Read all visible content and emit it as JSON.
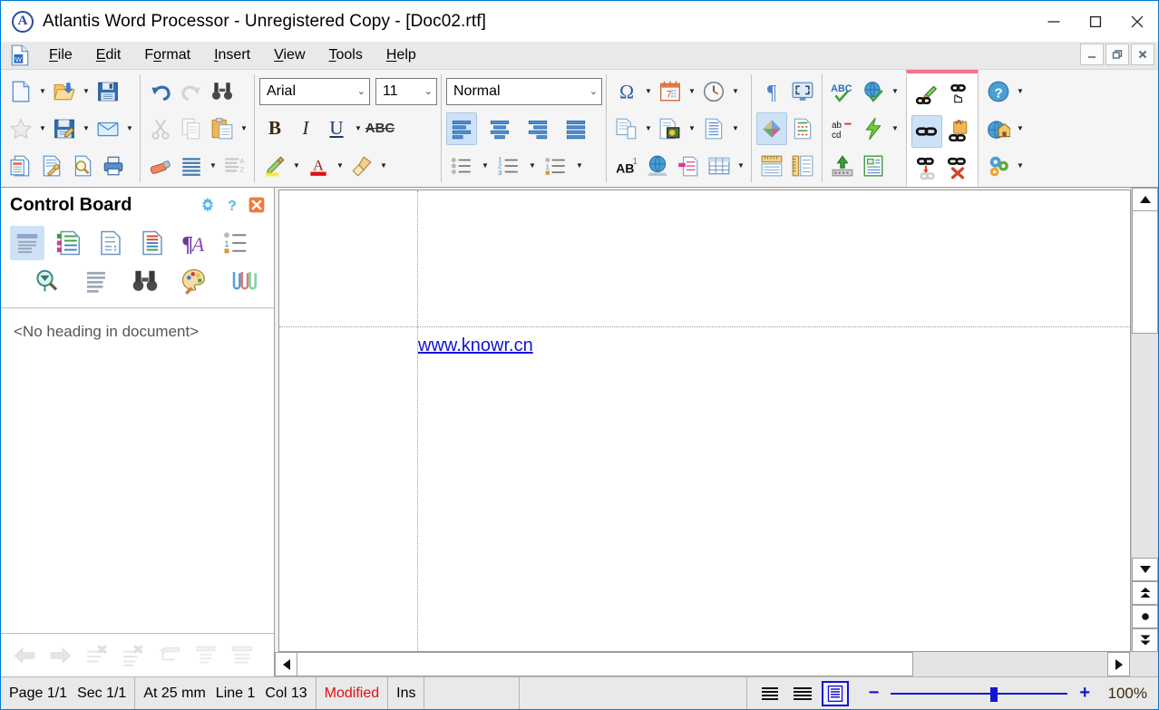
{
  "window": {
    "title": "Atlantis Word Processor - Unregistered Copy - [Doc02.rtf]",
    "logo_letter": "A",
    "minimize_label": "Minimize",
    "maximize_label": "Maximize",
    "close_label": "Close"
  },
  "menubar": {
    "items": [
      {
        "label": "File",
        "accel": "F"
      },
      {
        "label": "Edit",
        "accel": "E"
      },
      {
        "label": "Format",
        "accel": "o"
      },
      {
        "label": "Insert",
        "accel": "I"
      },
      {
        "label": "View",
        "accel": "V"
      },
      {
        "label": "Tools",
        "accel": "T"
      },
      {
        "label": "Help",
        "accel": "H"
      }
    ],
    "mdi": {
      "minimize": "_",
      "restore": "❐",
      "close": "✕"
    }
  },
  "toolbar": {
    "groups": [
      {
        "name": "file-group",
        "buttons": [
          "new-document-icon",
          "open-document-icon",
          "save-icon",
          "favorites-star-icon",
          "save-as-icon",
          "send-mail-icon",
          "document-properties-icon",
          "document-setup-icon",
          "print-preview-icon",
          "print-icon"
        ]
      },
      {
        "name": "edit-group",
        "buttons": [
          "undo-icon",
          "redo-icon",
          "find-icon",
          "cut-icon",
          "copy-icon",
          "paste-icon",
          "clear-formatting-icon",
          "paragraph-lines-icon",
          "sort-icon"
        ]
      },
      {
        "name": "font-group",
        "font_name": "Arial",
        "font_size": "11",
        "bold_label": "B",
        "italic_label": "I",
        "underline_label": "U",
        "strikethrough_label": "ABC",
        "buttons": [
          "highlight-icon",
          "font-color-icon",
          "format-painter-icon"
        ]
      },
      {
        "name": "paragraph-group",
        "style_name": "Normal",
        "buttons": [
          "align-left-icon",
          "align-center-icon",
          "align-right-icon",
          "align-justify-icon",
          "bullet-list-icon",
          "numbered-list-icon",
          "multilevel-list-icon"
        ]
      },
      {
        "name": "insert-group",
        "buttons": [
          "symbol-icon",
          "date-icon",
          "time-icon",
          "page-break-icon",
          "picture-icon",
          "text-box-icon",
          "footnote-icon",
          "hyperlink-globe-icon",
          "bookmark-icon",
          "table-icon"
        ]
      },
      {
        "name": "view-group",
        "buttons": [
          "show-marks-icon",
          "full-screen-icon",
          "page-layout-icon",
          "revisions-icon",
          "ruler-icon",
          "vertical-ruler-icon"
        ]
      },
      {
        "name": "tools-group",
        "buttons": [
          "spell-check-icon",
          "translate-icon",
          "autocorrect-icon",
          "power-type-icon",
          "keyboard-shortcut-icon",
          "word-count-icon"
        ]
      },
      {
        "name": "hyperlink-group",
        "active": true,
        "buttons": [
          "edit-hyperlink-icon",
          "insert-hyperlink-cursor-icon",
          "select-hyperlink-icon",
          "paste-as-hyperlink-icon",
          "hyperlink-target-icon",
          "remove-hyperlink-icon"
        ]
      },
      {
        "name": "help-group",
        "buttons": [
          "help-icon",
          "home-page-icon",
          "options-icon"
        ]
      }
    ]
  },
  "sidebar": {
    "title": "Control Board",
    "header_icons": [
      "gear-icon",
      "help-question-icon",
      "close-panel-icon"
    ],
    "tabs_row1": [
      "headings-pane-icon",
      "styles-pane-icon",
      "document-pane-icon",
      "revision-pane-icon",
      "font-pane-icon",
      "numbering-pane-icon"
    ],
    "tabs_row2": [
      "find-pane-icon",
      "lines-pane-icon",
      "binoculars-pane-icon",
      "palette-pane-icon",
      "clips-pane-icon"
    ],
    "content_message": "<No heading in document>",
    "footer_buttons": [
      "back-arrow-icon",
      "forward-arrow-icon",
      "delete-heading-icon",
      "delete-all-headings-icon",
      "promote-heading-icon",
      "demote-heading-icon",
      "expand-heading-icon"
    ]
  },
  "document": {
    "hyperlink_text": "www.knowr.cn"
  },
  "statusbar": {
    "page": "Page 1/1",
    "section": "Sec 1/1",
    "position": "At 25 mm",
    "line": "Line 1",
    "column": "Col 13",
    "modified": "Modified",
    "insert_mode": "Ins",
    "empty_cell": "",
    "views": [
      "normal-view-icon",
      "draft-view-icon",
      "page-view-icon"
    ],
    "active_view_index": 2,
    "zoom_minus": "−",
    "zoom_plus": "+",
    "zoom_level": "100%"
  },
  "colors": {
    "accent_blue": "#1414d2",
    "modified_red": "#e01010",
    "active_group_pink": "#f4768a",
    "selection_blue": "#cde2f7",
    "link_blue": "#1414d2"
  }
}
